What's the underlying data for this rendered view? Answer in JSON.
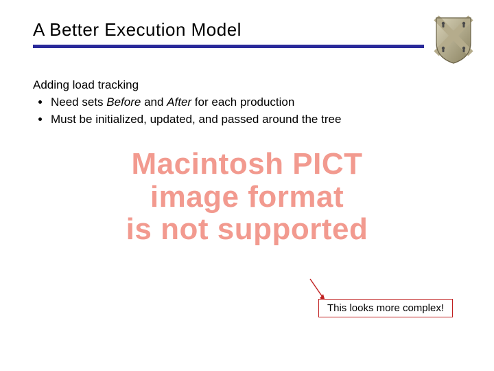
{
  "title": "A Better Execution Model",
  "lead": "Adding load tracking",
  "bullets": [
    {
      "prefix": "Need sets ",
      "em1": "Before",
      "mid": " and ",
      "em2": "After",
      "suffix": " for each production"
    },
    {
      "text": "Must be initialized, updated, and passed around the tree"
    }
  ],
  "pict": {
    "line1": "Macintosh PICT",
    "line2": "image format",
    "line3": "is not supported"
  },
  "callout": "This looks more complex!",
  "colors": {
    "rule": "#2a2a9a",
    "pict": "#f29a8f",
    "callout_border": "#c02020"
  }
}
